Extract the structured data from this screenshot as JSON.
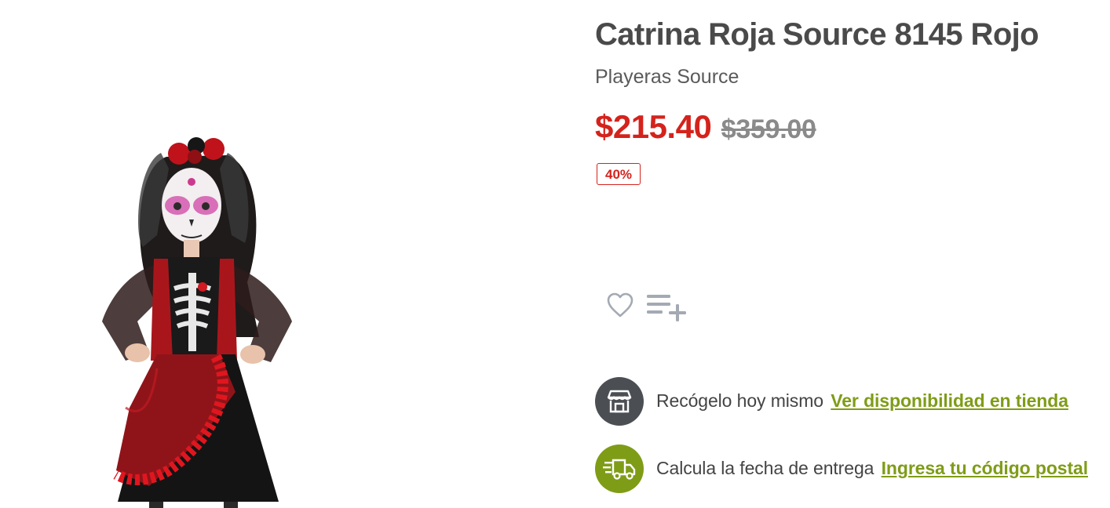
{
  "product": {
    "title": "Catrina Roja Source 8145 Rojo",
    "brand": "Playeras Source",
    "price_sale": "$215.40",
    "price_original": "$359.00",
    "discount_badge": "40%",
    "image_alt": "Catrina costume photo"
  },
  "actions": {
    "favorite_icon": "heart-icon",
    "add_to_list_icon": "playlist-add-icon"
  },
  "delivery": {
    "pickup": {
      "icon": "store-icon",
      "text": "Recógelo hoy mismo",
      "link": "Ver disponibilidad en tienda"
    },
    "shipping": {
      "icon": "truck-icon",
      "text": "Calcula la fecha de entrega",
      "link": "Ingresa tu código postal"
    }
  },
  "colors": {
    "sale_red": "#d4231c",
    "link_olive": "#7f9c17",
    "store_circle": "#4b4f54",
    "icon_gray": "#a4aab3"
  }
}
